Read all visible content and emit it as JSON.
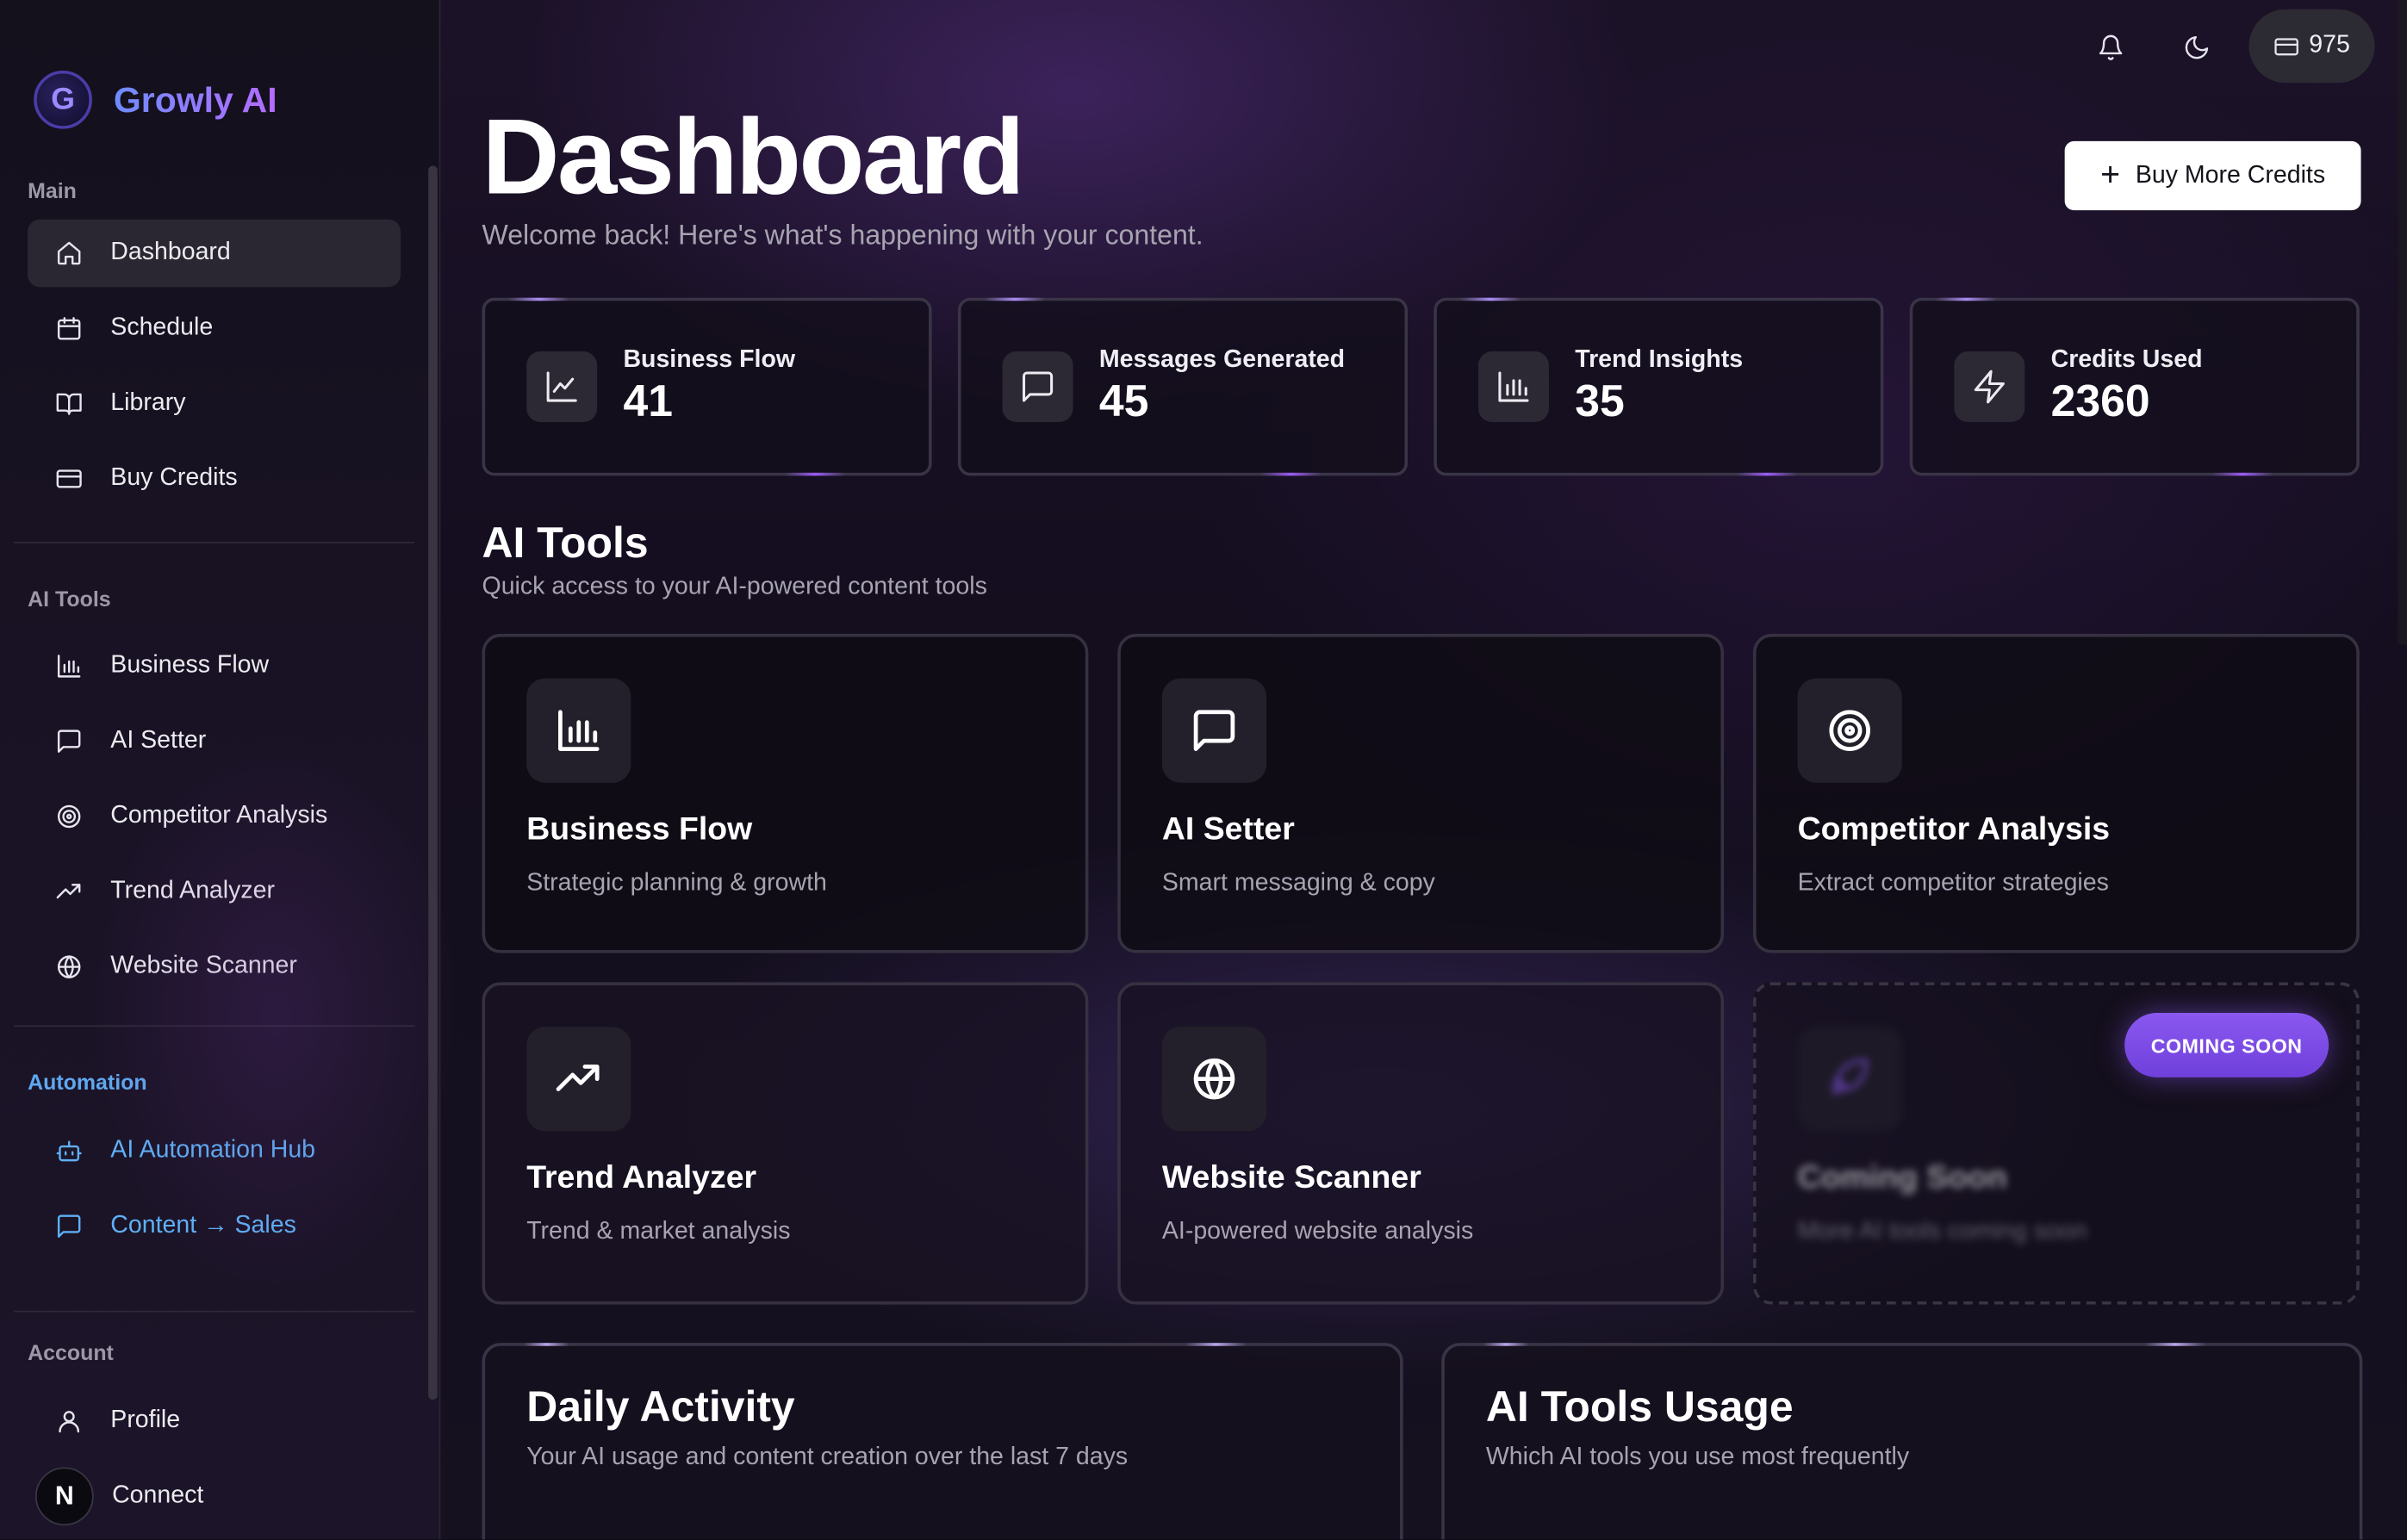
{
  "app": {
    "name": "Growly AI",
    "logo_letter": "G"
  },
  "sidebar": {
    "main": {
      "label": "Main",
      "items": [
        {
          "label": "Dashboard",
          "icon": "home-icon",
          "active": true
        },
        {
          "label": "Schedule",
          "icon": "calendar-icon"
        },
        {
          "label": "Library",
          "icon": "book-icon"
        },
        {
          "label": "Buy Credits",
          "icon": "credit-card-icon"
        }
      ]
    },
    "ai_tools": {
      "label": "AI Tools",
      "items": [
        {
          "label": "Business Flow",
          "icon": "bar-chart-icon"
        },
        {
          "label": "AI Setter",
          "icon": "message-icon"
        },
        {
          "label": "Competitor Analysis",
          "icon": "target-icon"
        },
        {
          "label": "Trend Analyzer",
          "icon": "trending-up-icon"
        },
        {
          "label": "Website Scanner",
          "icon": "globe-icon"
        }
      ]
    },
    "automation": {
      "label": "Automation",
      "items": [
        {
          "label": "AI Automation Hub",
          "icon": "bot-icon"
        },
        {
          "label": "Content → Sales",
          "icon": "message-icon"
        }
      ]
    },
    "account": {
      "label": "Account",
      "items": [
        {
          "label": "Profile",
          "icon": "user-icon"
        },
        {
          "label": "Connect",
          "icon": "n-avatar-icon",
          "avatar_letter": "N"
        }
      ]
    }
  },
  "topbar": {
    "credits": "975",
    "icons": [
      "bell-icon",
      "moon-icon",
      "credit-card-icon"
    ]
  },
  "header": {
    "title": "Dashboard",
    "subtitle": "Welcome back! Here's what's happening with your content.",
    "buy_button": "Buy More Credits"
  },
  "stats": [
    {
      "label": "Business Flow",
      "value": "41",
      "icon": "line-chart-icon"
    },
    {
      "label": "Messages Generated",
      "value": "45",
      "icon": "message-icon"
    },
    {
      "label": "Trend Insights",
      "value": "35",
      "icon": "bar-chart-icon"
    },
    {
      "label": "Credits Used",
      "value": "2360",
      "icon": "zap-icon"
    }
  ],
  "ai_tools": {
    "title": "AI Tools",
    "subtitle": "Quick access to your AI-powered content tools",
    "cards": [
      {
        "title": "Business Flow",
        "desc": "Strategic planning & growth",
        "icon": "bar-chart-icon"
      },
      {
        "title": "AI Setter",
        "desc": "Smart messaging & copy",
        "icon": "message-icon"
      },
      {
        "title": "Competitor Analysis",
        "desc": "Extract competitor strategies",
        "icon": "target-icon"
      },
      {
        "title": "Trend Analyzer",
        "desc": "Trend & market analysis",
        "icon": "trending-up-icon"
      },
      {
        "title": "Website Scanner",
        "desc": "AI-powered website analysis",
        "icon": "globe-icon"
      },
      {
        "title": "Coming Soon",
        "desc": "More AI tools coming soon",
        "icon": "rocket-icon",
        "badge": "COMING SOON"
      }
    ]
  },
  "panels": [
    {
      "title": "Daily Activity",
      "subtitle": "Your AI usage and content creation over the last 7 days"
    },
    {
      "title": "AI Tools Usage",
      "subtitle": "Which AI tools you use most frequently"
    }
  ],
  "colors": {
    "accent": "#8a58f0",
    "brand_gradient_start": "#6d8cff",
    "brand_gradient_end": "#b56bff",
    "automation_blue": "#5fb0f5"
  }
}
